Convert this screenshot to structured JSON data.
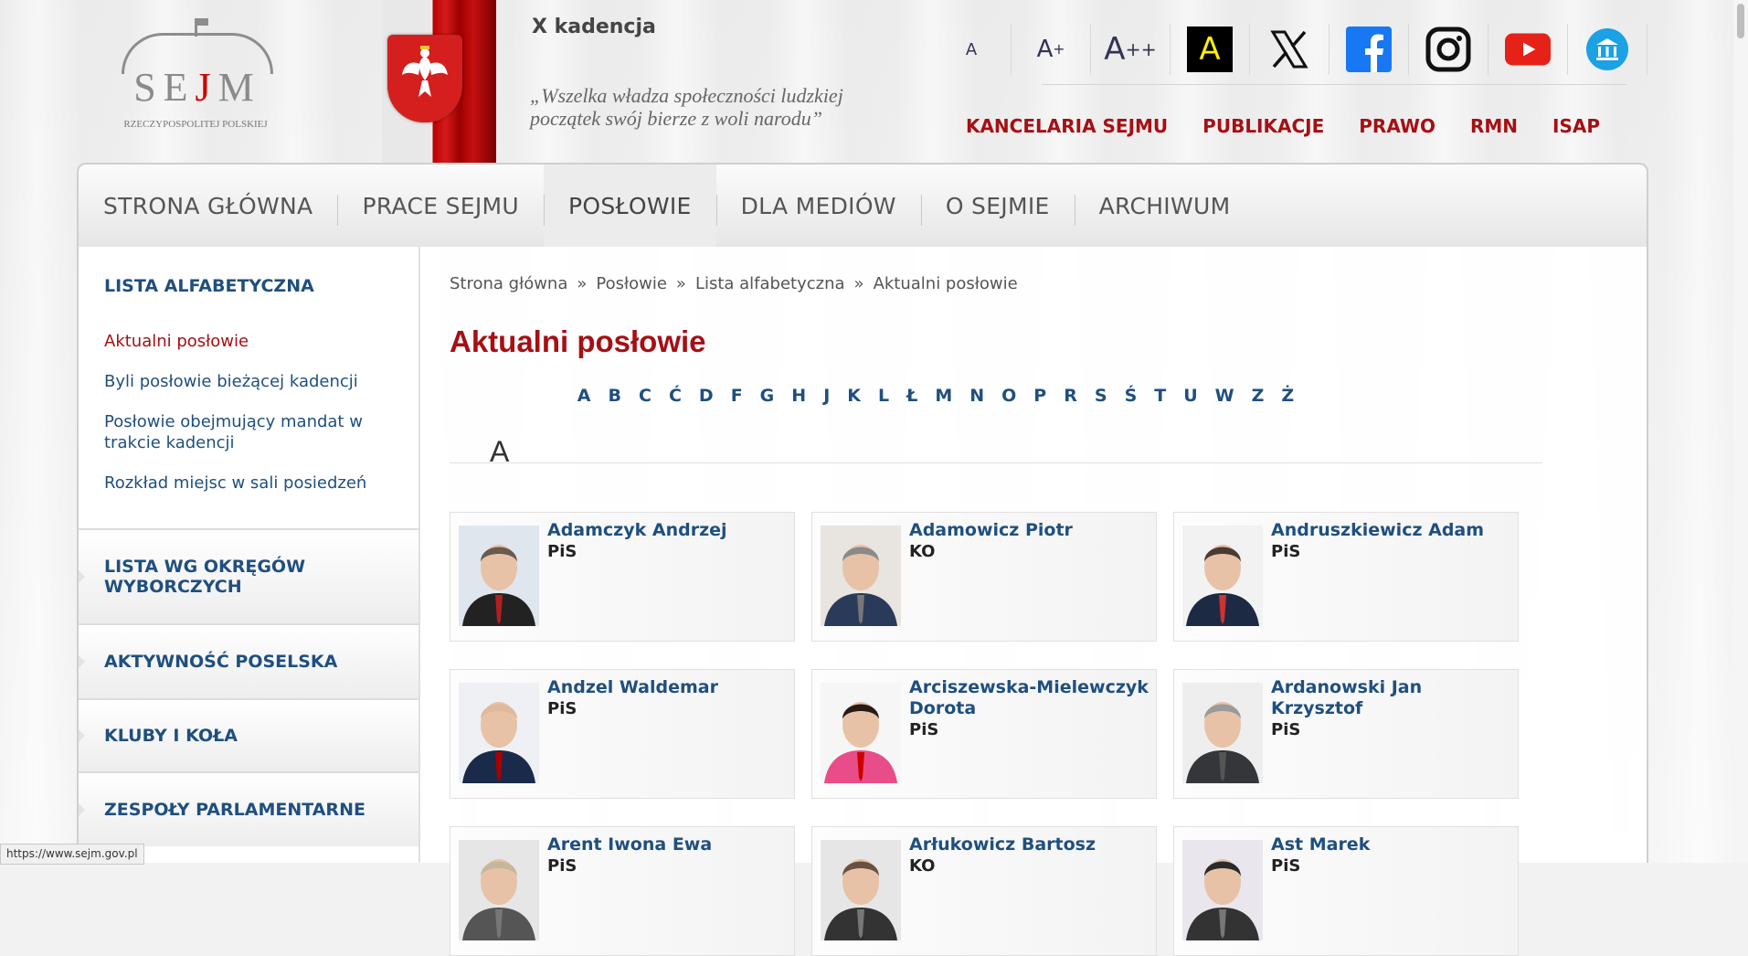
{
  "header": {
    "logo_word_pre": "SE",
    "logo_word_j": "J",
    "logo_word_post": "M",
    "logo_sub": "RZECZYPOSPOLITEJ POLSKIEJ",
    "kadencja": "X kadencja",
    "motto_line1": "„Wszelka władza społeczności ludzkiej",
    "motto_line2": "początek swój bierze z woli narodu”",
    "font_small": "A",
    "font_medium": "A",
    "font_medium_sup": "+",
    "font_large": "A",
    "font_large_sup": "++",
    "contrast_label": "A",
    "social_icons": [
      "x-icon",
      "facebook-icon",
      "instagram-icon",
      "youtube-icon",
      "museum-icon"
    ],
    "top_links": [
      "KANCELARIA SEJMU",
      "PUBLIKACJE",
      "PRAWO",
      "RMN",
      "ISAP"
    ]
  },
  "nav": {
    "items": [
      "STRONA GŁÓWNA",
      "PRACE SEJMU",
      "POSŁOWIE",
      "DLA MEDIÓW",
      "O SEJMIE",
      "ARCHIWUM"
    ],
    "active": "POSŁOWIE"
  },
  "sidebar": {
    "heading": "LISTA ALFABETYCZNA",
    "links": [
      "Aktualni posłowie",
      "Byli posłowie bieżącej kadencji",
      "Posłowie obejmujący mandat w trakcie kadencji",
      "Rozkład miejsc w sali posiedzeń"
    ],
    "sections": [
      "LISTA WG OKRĘGÓW WYBORCZYCH",
      "AKTYWNOŚĆ POSELSKA",
      "KLUBY I KOŁA",
      "ZESPOŁY PARLAMENTARNE"
    ]
  },
  "breadcrumb": [
    "Strona główna",
    "Posłowie",
    "Lista alfabetyczna",
    "Aktualni posłowie"
  ],
  "breadcrumb_sep": "»",
  "page_title": "Aktualni posłowie",
  "alphabet": [
    "A",
    "B",
    "C",
    "Ć",
    "D",
    "F",
    "G",
    "H",
    "J",
    "K",
    "L",
    "Ł",
    "M",
    "N",
    "O",
    "P",
    "R",
    "S",
    "Ś",
    "T",
    "U",
    "W",
    "Z",
    "Ż"
  ],
  "section_letter": "A",
  "deputies": [
    {
      "name": "Adamczyk Andrzej",
      "party": "PiS"
    },
    {
      "name": "Adamowicz Piotr",
      "party": "KO"
    },
    {
      "name": "Andruszkiewicz Adam",
      "party": "PiS"
    },
    {
      "name": "Andzel Waldemar",
      "party": "PiS"
    },
    {
      "name": "Arciszewska-Mielewczyk Dorota",
      "party": "PiS"
    },
    {
      "name": "Ardanowski Jan Krzysztof",
      "party": "PiS"
    },
    {
      "name": "Arent Iwona Ewa",
      "party": "PiS"
    },
    {
      "name": "Arłukowicz Bartosz",
      "party": "KO"
    },
    {
      "name": "Ast Marek",
      "party": "PiS"
    }
  ],
  "status_url": "https://www.sejm.gov.pl",
  "colors": {
    "accent_red": "#a60f14",
    "link_blue": "#1f4f7f"
  }
}
